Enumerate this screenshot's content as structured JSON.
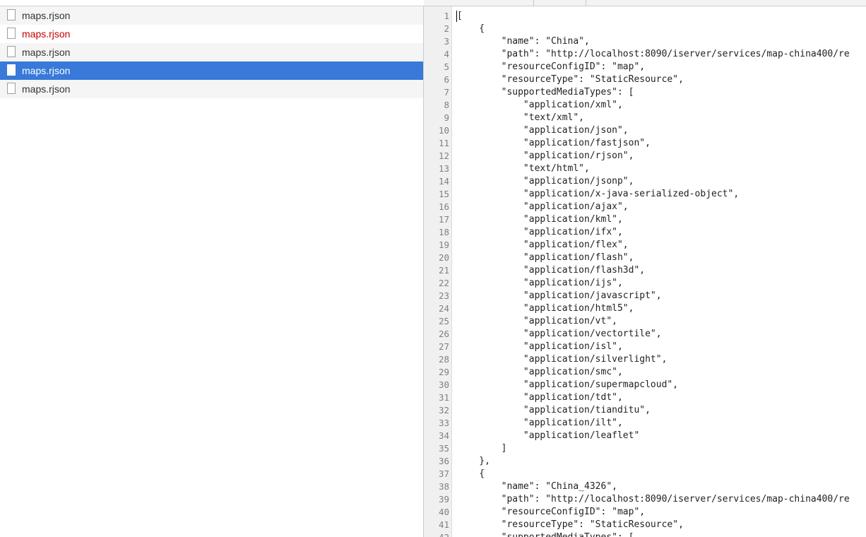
{
  "requests": [
    {
      "name": "maps.rjson",
      "state": "normal"
    },
    {
      "name": "maps.rjson",
      "state": "error"
    },
    {
      "name": "maps.rjson",
      "state": "normal"
    },
    {
      "name": "maps.rjson",
      "state": "selected"
    },
    {
      "name": "maps.rjson",
      "state": "normal"
    }
  ],
  "response": {
    "line_numbers": [
      "1",
      "2",
      "3",
      "4",
      "5",
      "6",
      "7",
      "8",
      "9",
      "10",
      "11",
      "12",
      "13",
      "14",
      "15",
      "16",
      "17",
      "18",
      "19",
      "20",
      "21",
      "22",
      "23",
      "24",
      "25",
      "26",
      "27",
      "28",
      "29",
      "30",
      "31",
      "32",
      "33",
      "34",
      "35",
      "36",
      "37",
      "38",
      "39",
      "40",
      "41",
      "42"
    ],
    "lines": [
      "[",
      "    {",
      "        \"name\": \"China\",",
      "        \"path\": \"http://localhost:8090/iserver/services/map-china400/re",
      "        \"resourceConfigID\": \"map\",",
      "        \"resourceType\": \"StaticResource\",",
      "        \"supportedMediaTypes\": [",
      "            \"application/xml\",",
      "            \"text/xml\",",
      "            \"application/json\",",
      "            \"application/fastjson\",",
      "            \"application/rjson\",",
      "            \"text/html\",",
      "            \"application/jsonp\",",
      "            \"application/x-java-serialized-object\",",
      "            \"application/ajax\",",
      "            \"application/kml\",",
      "            \"application/ifx\",",
      "            \"application/flex\",",
      "            \"application/flash\",",
      "            \"application/flash3d\",",
      "            \"application/ijs\",",
      "            \"application/javascript\",",
      "            \"application/html5\",",
      "            \"application/vt\",",
      "            \"application/vectortile\",",
      "            \"application/isl\",",
      "            \"application/silverlight\",",
      "            \"application/smc\",",
      "            \"application/supermapcloud\",",
      "            \"application/tdt\",",
      "            \"application/tianditu\",",
      "            \"application/ilt\",",
      "            \"application/leaflet\"",
      "        ]",
      "    },",
      "    {",
      "        \"name\": \"China_4326\",",
      "        \"path\": \"http://localhost:8090/iserver/services/map-china400/re",
      "        \"resourceConfigID\": \"map\",",
      "        \"resourceType\": \"StaticResource\",",
      "        \"supportedMediaTypes\": ["
    ]
  },
  "icons": {
    "request_row": "file-icon"
  },
  "colors": {
    "selected_row": "#3879d9",
    "error_text": "#c80000",
    "gutter_bg": "#f0f0f0"
  }
}
